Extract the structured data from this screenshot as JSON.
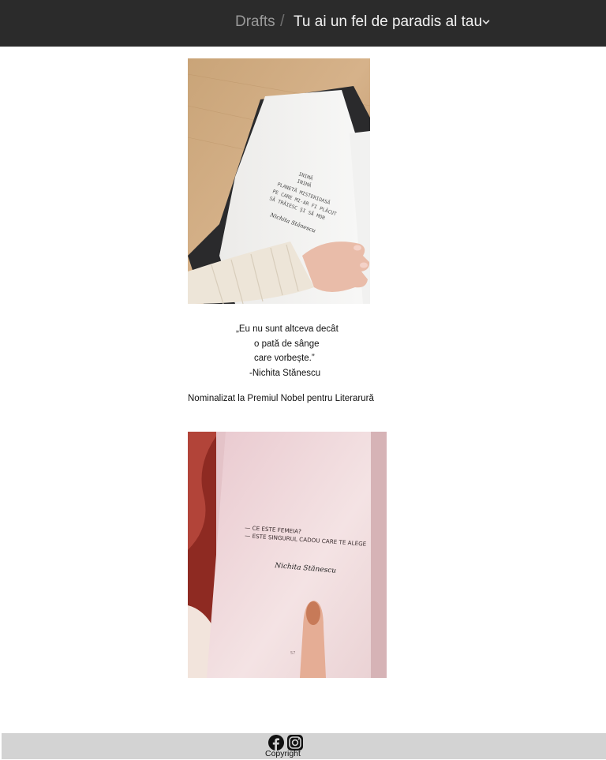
{
  "header": {
    "breadcrumb_root": "Drafts",
    "separator": "/",
    "title": "Tu ai un fel de paradis al tau",
    "dropdown_icon": "chevron-down-icon",
    "background": "#2b2b2b"
  },
  "content": {
    "photo1": {
      "description_text_lines": [
        "INIMĂ",
        "INIMĂ",
        "PLANETĂ MISTERIOASĂ",
        "PE CARE MI-AR FI PLĂCUT",
        "SĂ TRĂIESC ȘI SĂ MOR"
      ],
      "signature": "Nichita Stănescu"
    },
    "quote": {
      "line1": "„Eu nu sunt altceva decât",
      "line2": "o pată de sânge",
      "line3": "care vorbește.”",
      "author": "-Nichita Stănescu"
    },
    "nominee": "Nominalizat la Premiul Nobel pentru Literarură",
    "photo2": {
      "text_line1": "— CE ESTE FEMEIA?",
      "text_line2": "— ESTE SINGURUL CADOU CARE TE ALEGE",
      "signature": "Nichita Stănescu",
      "page_number": "57"
    }
  },
  "footer": {
    "facebook_icon": "facebook-icon",
    "instagram_icon": "instagram-icon",
    "copyright": "Copyright",
    "background": "#d3d3d3"
  }
}
